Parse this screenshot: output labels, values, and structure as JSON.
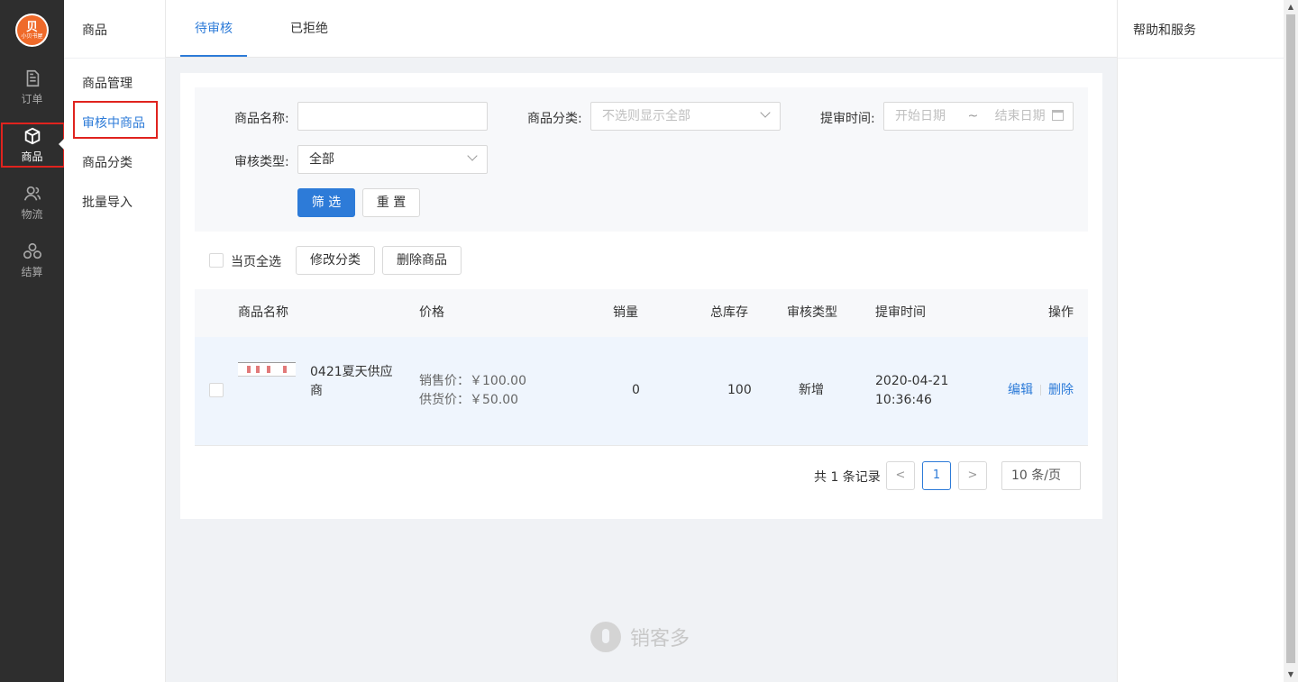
{
  "brand": {
    "logo_mark": "贝",
    "logo_text": "小贝书屋"
  },
  "rail": {
    "items": [
      {
        "label": "订单",
        "icon": "document-icon"
      },
      {
        "label": "商品",
        "icon": "box-icon",
        "active": true
      },
      {
        "label": "物流",
        "icon": "people-icon"
      },
      {
        "label": "结算",
        "icon": "settle-icon"
      }
    ]
  },
  "subnav": {
    "title": "商品",
    "items": [
      {
        "label": "商品管理"
      },
      {
        "label": "审核中商品",
        "active": true
      },
      {
        "label": "商品分类"
      },
      {
        "label": "批量导入"
      }
    ]
  },
  "tabs": [
    {
      "label": "待审核",
      "active": true
    },
    {
      "label": "已拒绝"
    }
  ],
  "help": {
    "title": "帮助和服务"
  },
  "filter": {
    "name_label": "商品名称:",
    "name_value": "",
    "category_label": "商品分类:",
    "category_placeholder": "不选则显示全部",
    "time_label": "提审时间:",
    "start_placeholder": "开始日期",
    "range_sep": "~",
    "end_placeholder": "结束日期",
    "type_label": "审核类型:",
    "type_value": "全部",
    "filter_btn": "筛 选",
    "reset_btn": "重 置"
  },
  "bulk": {
    "select_all": "当页全选",
    "change_category": "修改分类",
    "delete": "删除商品"
  },
  "table": {
    "headers": [
      "商品名称",
      "价格",
      "销量",
      "总库存",
      "审核类型",
      "提审时间",
      "操作"
    ],
    "rows": [
      {
        "name_line1": "0421夏天供应",
        "name_line2": "商",
        "sale_price": "销售价：￥100.00",
        "supply_price": "供货价：￥50.00",
        "sales": "0",
        "stock": "100",
        "type": "新增",
        "date": "2020-04-21",
        "time": "10:36:46",
        "edit": "编辑",
        "delete": "删除"
      }
    ]
  },
  "pagination": {
    "total": "共 1 条记录",
    "prev": "<",
    "current": "1",
    "next": ">",
    "page_size": "10 条/页"
  },
  "watermark": "销客多",
  "colors": {
    "accent": "#2d7bd8",
    "highlight": "#e0231e",
    "rail": "#2e2e2e"
  }
}
